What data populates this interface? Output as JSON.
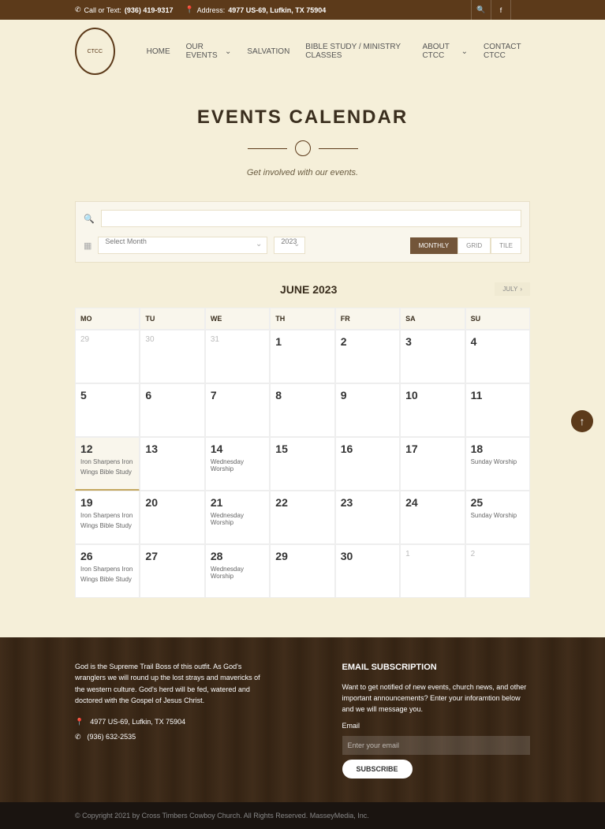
{
  "topbar": {
    "call_label": "Call or Text:",
    "phone": "(936) 419-9317",
    "address_label": "Address:",
    "address": "4977 US-69, Lufkin, TX 75904"
  },
  "nav": {
    "items": [
      "HOME",
      "OUR EVENTS",
      "SALVATION",
      "BIBLE STUDY / MINISTRY CLASSES",
      "ABOUT CTCC",
      "CONTACT CTCC"
    ]
  },
  "page": {
    "title": "EVENTS CALENDAR",
    "subtitle": "Get involved with our events."
  },
  "filter": {
    "month_placeholder": "Select Month",
    "year": "2023",
    "views": [
      "MONTHLY",
      "GRID",
      "TILE"
    ]
  },
  "calendar": {
    "month_label": "JUNE 2023",
    "next_label": "JULY",
    "days": [
      "MO",
      "TU",
      "WE",
      "TH",
      "FR",
      "SA",
      "SU"
    ],
    "cells": [
      {
        "n": "29",
        "muted": true
      },
      {
        "n": "30",
        "muted": true
      },
      {
        "n": "31",
        "muted": true
      },
      {
        "n": "1"
      },
      {
        "n": "2"
      },
      {
        "n": "3"
      },
      {
        "n": "4"
      },
      {
        "n": "5"
      },
      {
        "n": "6"
      },
      {
        "n": "7"
      },
      {
        "n": "8"
      },
      {
        "n": "9"
      },
      {
        "n": "10"
      },
      {
        "n": "11"
      },
      {
        "n": "12",
        "today": true,
        "events": [
          "Iron Sharpens Iron",
          "Wings Bible Study"
        ]
      },
      {
        "n": "13"
      },
      {
        "n": "14",
        "events": [
          "Wednesday Worship"
        ]
      },
      {
        "n": "15"
      },
      {
        "n": "16"
      },
      {
        "n": "17"
      },
      {
        "n": "18",
        "events": [
          "Sunday Worship"
        ]
      },
      {
        "n": "19",
        "events": [
          "Iron Sharpens Iron",
          "Wings Bible Study"
        ]
      },
      {
        "n": "20"
      },
      {
        "n": "21",
        "events": [
          "Wednesday Worship"
        ]
      },
      {
        "n": "22"
      },
      {
        "n": "23"
      },
      {
        "n": "24"
      },
      {
        "n": "25",
        "events": [
          "Sunday Worship"
        ]
      },
      {
        "n": "26",
        "events": [
          "Iron Sharpens Iron",
          "Wings Bible Study"
        ]
      },
      {
        "n": "27"
      },
      {
        "n": "28",
        "events": [
          "Wednesday Worship"
        ]
      },
      {
        "n": "29"
      },
      {
        "n": "30"
      },
      {
        "n": "1",
        "muted": true
      },
      {
        "n": "2",
        "muted": true
      }
    ]
  },
  "footer": {
    "about": "God is the Supreme Trail Boss of this outfit. As God's wranglers we will round up the lost strays and mavericks of the western culture. God's herd will be fed, watered and doctored with the Gospel of Jesus Christ.",
    "address": "4977 US-69, Lufkin, TX 75904",
    "phone": "(936) 632-2535",
    "sub_title": "EMAIL SUBSCRIPTION",
    "sub_text": "Want to get notified of new events, church news, and other important announcements? Enter your inforamtion below and we will message you.",
    "email_label": "Email",
    "email_placeholder": "Enter your email",
    "subscribe": "SUBSCRIBE"
  },
  "copyright": "© Copyright 2021 by Cross Timbers Cowboy Church. All Rights Reserved. MasseyMedia, Inc."
}
